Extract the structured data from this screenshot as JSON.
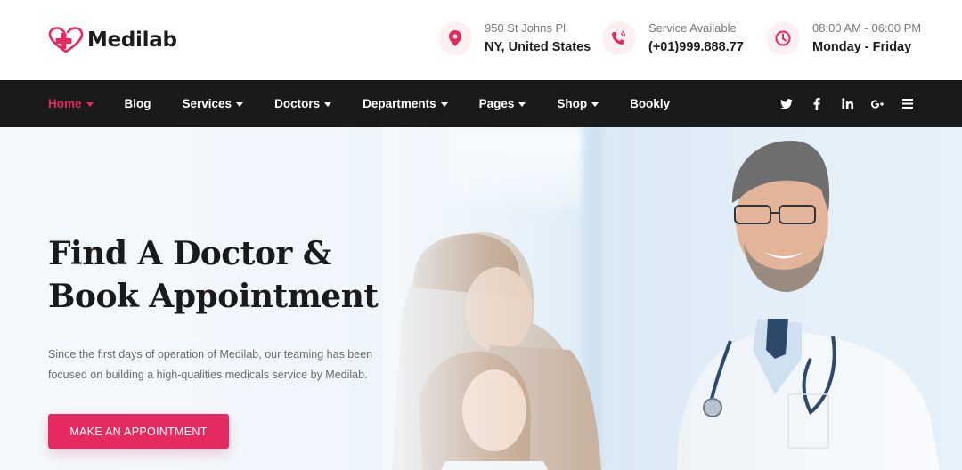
{
  "brand": {
    "name": "Medilab",
    "accent_color": "#e42a5e",
    "nav_bg": "#1a1a1a"
  },
  "header": {
    "info": [
      {
        "icon": "map-pin-icon",
        "small": "950 St Johns Pl",
        "big": "NY, United States"
      },
      {
        "icon": "phone-icon",
        "small": "Service Available",
        "big": "(+01)999.888.77"
      },
      {
        "icon": "clock-icon",
        "small": "08:00 AM - 06:00 PM",
        "big": "Monday - Friday"
      }
    ]
  },
  "nav": {
    "items": [
      {
        "label": "Home",
        "dropdown": true,
        "active": true
      },
      {
        "label": "Blog",
        "dropdown": false
      },
      {
        "label": "Services",
        "dropdown": true
      },
      {
        "label": "Doctors",
        "dropdown": true
      },
      {
        "label": "Departments",
        "dropdown": true
      },
      {
        "label": "Pages",
        "dropdown": true
      },
      {
        "label": "Shop",
        "dropdown": true
      },
      {
        "label": "Bookly",
        "dropdown": false
      }
    ],
    "social": [
      "twitter-icon",
      "facebook-icon",
      "linkedin-icon",
      "google-plus-icon",
      "menu-icon"
    ]
  },
  "hero": {
    "title_line1": "Find A Doctor &",
    "title_line2": "Book Appointment",
    "description": "Since the first days of operation of Medilab, our teaming has been focused on building a high-qualities medicals service by Medilab.",
    "cta_label": "MAKE AN APPOINTMENT"
  }
}
